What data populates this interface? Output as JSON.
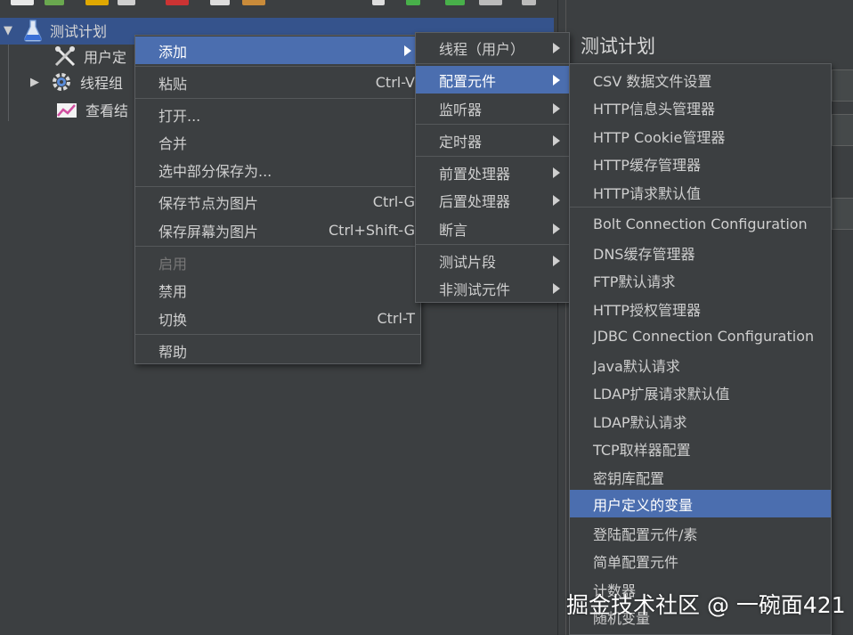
{
  "tree": {
    "root_label": "测试计划",
    "children": [
      {
        "label": "用户定",
        "icon": "tools-icon"
      },
      {
        "label": "线程组",
        "icon": "gear-icon"
      },
      {
        "label": "查看结",
        "icon": "chart-icon"
      }
    ]
  },
  "right_panel": {
    "title": "测试计划"
  },
  "context_menu": {
    "items": [
      {
        "label": "添加",
        "shortcut": "",
        "submenu": true,
        "selected": true
      },
      {
        "label": "粘贴",
        "shortcut": "Ctrl-V"
      },
      {
        "label": "打开...",
        "shortcut": ""
      },
      {
        "label": "合并",
        "shortcut": ""
      },
      {
        "label": "选中部分保存为...",
        "shortcut": ""
      },
      {
        "label": "保存节点为图片",
        "shortcut": "Ctrl-G"
      },
      {
        "label": "保存屏幕为图片",
        "shortcut": "Ctrl+Shift-G"
      },
      {
        "label": "启用",
        "shortcut": "",
        "disabled": true
      },
      {
        "label": "禁用",
        "shortcut": ""
      },
      {
        "label": "切换",
        "shortcut": "Ctrl-T"
      },
      {
        "label": "帮助",
        "shortcut": ""
      }
    ]
  },
  "add_submenu": {
    "items": [
      {
        "label": "线程（用户）"
      },
      {
        "label": "配置元件",
        "selected": true
      },
      {
        "label": "监听器"
      },
      {
        "label": "定时器"
      },
      {
        "label": "前置处理器"
      },
      {
        "label": "后置处理器"
      },
      {
        "label": "断言"
      },
      {
        "label": "测试片段"
      },
      {
        "label": "非测试元件"
      }
    ]
  },
  "config_submenu": {
    "items": [
      {
        "label": "CSV 数据文件设置"
      },
      {
        "label": "HTTP信息头管理器"
      },
      {
        "label": "HTTP Cookie管理器"
      },
      {
        "label": "HTTP缓存管理器"
      },
      {
        "label": "HTTP请求默认值"
      },
      {
        "label": "Bolt Connection Configuration"
      },
      {
        "label": "DNS缓存管理器"
      },
      {
        "label": "FTP默认请求"
      },
      {
        "label": "HTTP授权管理器"
      },
      {
        "label": "JDBC Connection Configuration"
      },
      {
        "label": "Java默认请求"
      },
      {
        "label": "LDAP扩展请求默认值"
      },
      {
        "label": "LDAP默认请求"
      },
      {
        "label": "TCP取样器配置"
      },
      {
        "label": "密钥库配置"
      },
      {
        "label": "用户定义的变量",
        "selected": true
      },
      {
        "label": "登陆配置元件/素"
      },
      {
        "label": "简单配置元件"
      },
      {
        "label": "计数器"
      },
      {
        "label": "随机变量"
      }
    ]
  },
  "watermark": "掘金技术社区 @ 一碗面421",
  "colors": {
    "background": "#3c3f41",
    "selection": "#4b6eaf",
    "text": "#cfcfcf"
  }
}
